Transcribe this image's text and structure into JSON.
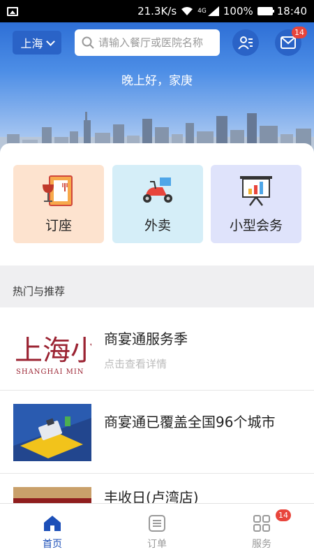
{
  "status_bar": {
    "speed": "21.3K/s",
    "network": "4G",
    "battery": "100%",
    "time": "18:40"
  },
  "header": {
    "city": "上海",
    "search_placeholder": "请输入餐厅或医院名称",
    "message_badge": "14",
    "greeting": "晚上好，家庚"
  },
  "services": [
    {
      "label": "订座",
      "icon": "menu-wine-icon",
      "bg": "#fde3cf"
    },
    {
      "label": "外卖",
      "icon": "scooter-icon",
      "bg": "#d5eef8"
    },
    {
      "label": "小型会务",
      "icon": "presentation-board-icon",
      "bg": "#dfe3fb"
    }
  ],
  "section": {
    "title": "热门与推荐"
  },
  "list": [
    {
      "title": "商宴通服务季",
      "subtitle": "点击查看详情",
      "logo_text_cn": "上海小南国",
      "logo_text_en": "SHANGHAI MIN"
    },
    {
      "title": "商宴通已覆盖全国96个城市"
    },
    {
      "title": "丰收日(卢湾店)"
    }
  ],
  "tabbar": {
    "items": [
      {
        "label": "首页",
        "active": true
      },
      {
        "label": "订单",
        "active": false
      },
      {
        "label": "服务",
        "active": false,
        "badge": "14"
      }
    ]
  },
  "colors": {
    "primary": "#2a63c7",
    "badge": "#e8453c"
  }
}
